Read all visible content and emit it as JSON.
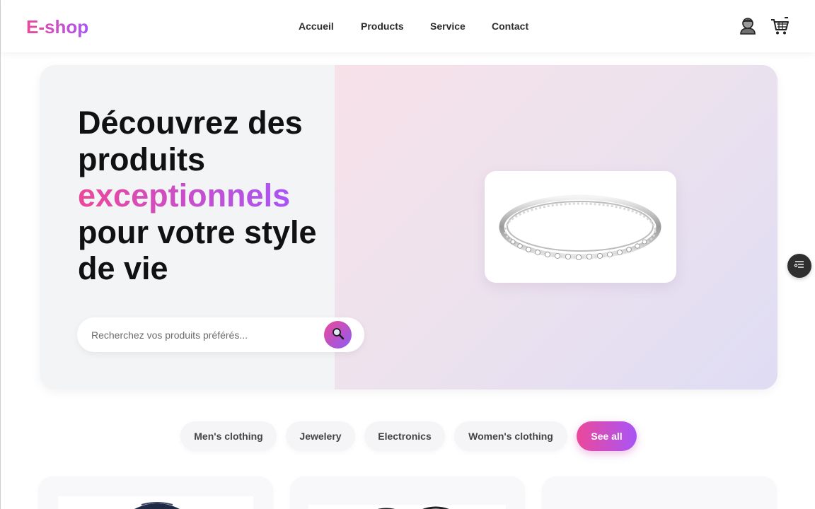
{
  "header": {
    "logo": "E-shop",
    "nav": [
      "Accueil",
      "Products",
      "Service",
      "Contact"
    ],
    "icons": {
      "account": "user-icon",
      "cart": "cart-icon"
    }
  },
  "hero": {
    "title_line1": "Découvrez des",
    "title_line2": "produits",
    "title_accent": "exceptionnels",
    "title_line4": "pour votre style",
    "title_line5": "de vie",
    "search_placeholder": "Recherchez vos produits préférés...",
    "search_icon": "search-icon",
    "featured_product_image": "silver diamond ring"
  },
  "categories": {
    "items": [
      "Men's clothing",
      "Jewelery",
      "Electronics",
      "Women's clothing"
    ],
    "see_all": "See all"
  },
  "colors": {
    "accent_start": "#ec4899",
    "accent_end": "#a855f7",
    "text_dark": "#111111"
  }
}
